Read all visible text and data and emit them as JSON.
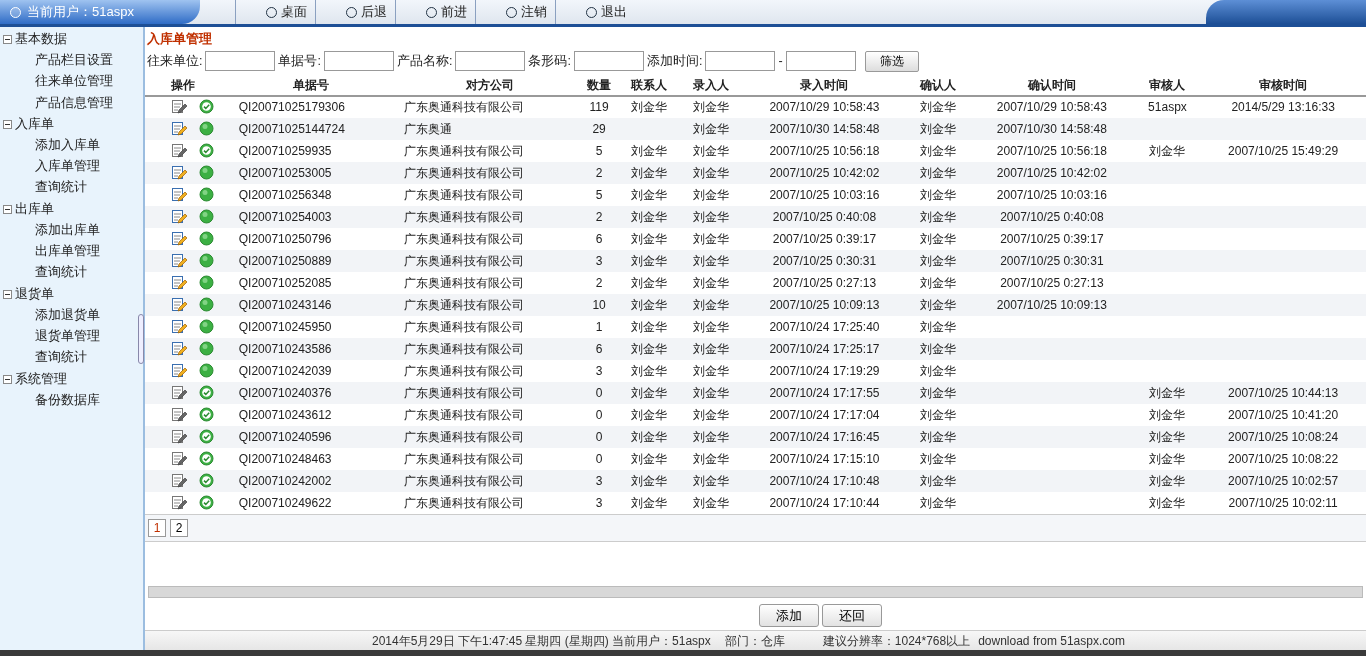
{
  "header": {
    "user_label": "当前用户：51aspx",
    "nav": [
      "桌面",
      "后退",
      "前进",
      "注销",
      "退出"
    ]
  },
  "sidebar": {
    "groups": [
      {
        "label": "基本数据",
        "expanded": true,
        "items": [
          "产品栏目设置",
          "往来单位管理",
          "产品信息管理"
        ]
      },
      {
        "label": "入库单",
        "expanded": true,
        "items": [
          "添加入库单",
          "入库单管理",
          "查询统计"
        ]
      },
      {
        "label": "出库单",
        "expanded": true,
        "items": [
          "添加出库单",
          "出库单管理",
          "查询统计"
        ]
      },
      {
        "label": "退货单",
        "expanded": true,
        "items": [
          "添加退货单",
          "退货单管理",
          "查询统计"
        ]
      },
      {
        "label": "系统管理",
        "expanded": true,
        "items": [
          "备份数据库"
        ]
      }
    ]
  },
  "page_title": "入库单管理",
  "filters": {
    "fields": [
      "往来单位:",
      "单据号:",
      "产品名称:",
      "条形码:",
      "添加时间:"
    ],
    "range_separator": "-",
    "button": "筛选"
  },
  "table": {
    "columns": [
      "操作",
      "单据号",
      "对方公司",
      "数量",
      "联系人",
      "录入人",
      "录入时间",
      "确认人",
      "确认时间",
      "审核人",
      "审核时间"
    ],
    "rows": [
      {
        "audited": true,
        "no": "QI20071025179306",
        "company": "广东奥通科技有限公司",
        "qty": "119",
        "contact": "刘金华",
        "entered_by": "刘金华",
        "entered_at": "2007/10/29 10:58:43",
        "confirmed_by": "刘金华",
        "confirmed_at": "2007/10/29 10:58:43",
        "audited_by": "51aspx",
        "audited_at": "2014/5/29 13:16:33"
      },
      {
        "audited": false,
        "no": "QI20071025144724",
        "company": "广东奥通",
        "qty": "29",
        "entered_by": "刘金华",
        "entered_at": "2007/10/30 14:58:48",
        "confirmed_by": "刘金华",
        "confirmed_at": "2007/10/30 14:58:48"
      },
      {
        "audited": true,
        "no": "QI200710259935",
        "company": "广东奥通科技有限公司",
        "qty": "5",
        "contact": "刘金华",
        "entered_by": "刘金华",
        "entered_at": "2007/10/25 10:56:18",
        "confirmed_by": "刘金华",
        "confirmed_at": "2007/10/25 10:56:18",
        "audited_by": "刘金华",
        "audited_at": "2007/10/25 15:49:29"
      },
      {
        "audited": false,
        "no": "QI200710253005",
        "company": "广东奥通科技有限公司",
        "qty": "2",
        "contact": "刘金华",
        "entered_by": "刘金华",
        "entered_at": "2007/10/25 10:42:02",
        "confirmed_by": "刘金华",
        "confirmed_at": "2007/10/25 10:42:02"
      },
      {
        "audited": false,
        "no": "QI200710256348",
        "company": "广东奥通科技有限公司",
        "qty": "5",
        "contact": "刘金华",
        "entered_by": "刘金华",
        "entered_at": "2007/10/25 10:03:16",
        "confirmed_by": "刘金华",
        "confirmed_at": "2007/10/25 10:03:16"
      },
      {
        "audited": false,
        "no": "QI200710254003",
        "company": "广东奥通科技有限公司",
        "qty": "2",
        "contact": "刘金华",
        "entered_by": "刘金华",
        "entered_at": "2007/10/25 0:40:08",
        "confirmed_by": "刘金华",
        "confirmed_at": "2007/10/25 0:40:08"
      },
      {
        "audited": false,
        "no": "QI200710250796",
        "company": "广东奥通科技有限公司",
        "qty": "6",
        "contact": "刘金华",
        "entered_by": "刘金华",
        "entered_at": "2007/10/25 0:39:17",
        "confirmed_by": "刘金华",
        "confirmed_at": "2007/10/25 0:39:17"
      },
      {
        "audited": false,
        "no": "QI200710250889",
        "company": "广东奥通科技有限公司",
        "qty": "3",
        "contact": "刘金华",
        "entered_by": "刘金华",
        "entered_at": "2007/10/25 0:30:31",
        "confirmed_by": "刘金华",
        "confirmed_at": "2007/10/25 0:30:31"
      },
      {
        "audited": false,
        "no": "QI200710252085",
        "company": "广东奥通科技有限公司",
        "qty": "2",
        "contact": "刘金华",
        "entered_by": "刘金华",
        "entered_at": "2007/10/25 0:27:13",
        "confirmed_by": "刘金华",
        "confirmed_at": "2007/10/25 0:27:13"
      },
      {
        "audited": false,
        "no": "QI200710243146",
        "company": "广东奥通科技有限公司",
        "qty": "10",
        "contact": "刘金华",
        "entered_by": "刘金华",
        "entered_at": "2007/10/25 10:09:13",
        "confirmed_by": "刘金华",
        "confirmed_at": "2007/10/25 10:09:13"
      },
      {
        "audited": false,
        "no": "QI200710245950",
        "company": "广东奥通科技有限公司",
        "qty": "1",
        "contact": "刘金华",
        "entered_by": "刘金华",
        "entered_at": "2007/10/24 17:25:40",
        "confirmed_by": "刘金华"
      },
      {
        "audited": false,
        "no": "QI200710243586",
        "company": "广东奥通科技有限公司",
        "qty": "6",
        "contact": "刘金华",
        "entered_by": "刘金华",
        "entered_at": "2007/10/24 17:25:17",
        "confirmed_by": "刘金华"
      },
      {
        "audited": false,
        "no": "QI200710242039",
        "company": "广东奥通科技有限公司",
        "qty": "3",
        "contact": "刘金华",
        "entered_by": "刘金华",
        "entered_at": "2007/10/24 17:19:29",
        "confirmed_by": "刘金华"
      },
      {
        "audited": true,
        "no": "QI200710240376",
        "company": "广东奥通科技有限公司",
        "qty": "0",
        "contact": "刘金华",
        "entered_by": "刘金华",
        "entered_at": "2007/10/24 17:17:55",
        "confirmed_by": "刘金华",
        "audited_by": "刘金华",
        "audited_at": "2007/10/25 10:44:13"
      },
      {
        "audited": true,
        "no": "QI200710243612",
        "company": "广东奥通科技有限公司",
        "qty": "0",
        "contact": "刘金华",
        "entered_by": "刘金华",
        "entered_at": "2007/10/24 17:17:04",
        "confirmed_by": "刘金华",
        "audited_by": "刘金华",
        "audited_at": "2007/10/25 10:41:20"
      },
      {
        "audited": true,
        "no": "QI200710240596",
        "company": "广东奥通科技有限公司",
        "qty": "0",
        "contact": "刘金华",
        "entered_by": "刘金华",
        "entered_at": "2007/10/24 17:16:45",
        "confirmed_by": "刘金华",
        "audited_by": "刘金华",
        "audited_at": "2007/10/25 10:08:24"
      },
      {
        "audited": true,
        "no": "QI200710248463",
        "company": "广东奥通科技有限公司",
        "qty": "0",
        "contact": "刘金华",
        "entered_by": "刘金华",
        "entered_at": "2007/10/24 17:15:10",
        "confirmed_by": "刘金华",
        "audited_by": "刘金华",
        "audited_at": "2007/10/25 10:08:22"
      },
      {
        "audited": true,
        "no": "QI200710242002",
        "company": "广东奥通科技有限公司",
        "qty": "3",
        "contact": "刘金华",
        "entered_by": "刘金华",
        "entered_at": "2007/10/24 17:10:48",
        "confirmed_by": "刘金华",
        "audited_by": "刘金华",
        "audited_at": "2007/10/25 10:02:57"
      },
      {
        "audited": true,
        "no": "QI200710249622",
        "company": "广东奥通科技有限公司",
        "qty": "3",
        "contact": "刘金华",
        "entered_by": "刘金华",
        "entered_at": "2007/10/24 17:10:44",
        "confirmed_by": "刘金华",
        "audited_by": "刘金华",
        "audited_at": "2007/10/25 10:02:11"
      }
    ]
  },
  "pager": [
    {
      "label": "1",
      "selected": true
    },
    {
      "label": "2",
      "selected": false
    }
  ],
  "buttons": [
    "添加",
    "还回"
  ],
  "status_bar": [
    "2014年5月29日 下午1:47:45 星期四 (星期四) 当前用户：51aspx",
    "部门：仓库",
    "建议分辨率：1024*768以上",
    "download from 51aspx.com"
  ]
}
